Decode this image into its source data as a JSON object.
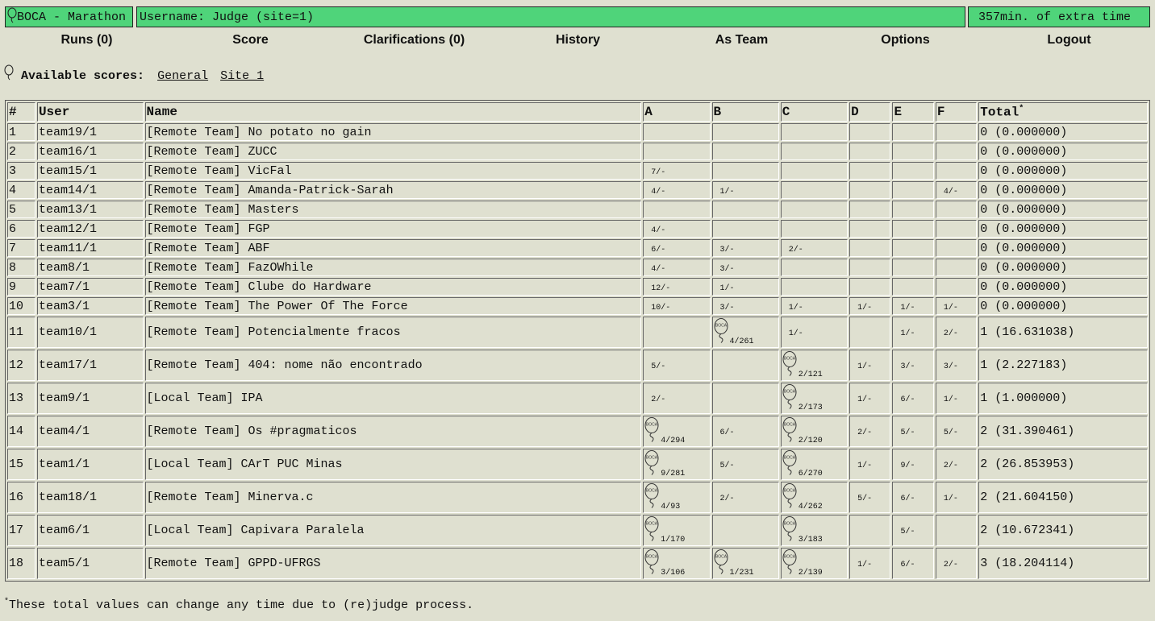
{
  "topbar": {
    "logo_text": "BOCA - Marathon",
    "user_text": "Username: Judge (site=1)",
    "time_text": "357min. of extra time",
    "bar_color": "#4fd47a"
  },
  "menu": [
    "Runs (0)",
    "Score",
    "Clarifications (0)",
    "History",
    "As Team",
    "Options",
    "Logout"
  ],
  "available": {
    "label": "Available scores:",
    "links": [
      "General",
      "Site_1"
    ]
  },
  "table": {
    "headers": [
      "#",
      "User",
      "Name",
      "A",
      "B",
      "C",
      "D",
      "E",
      "F",
      "Total"
    ],
    "total_mark": "*",
    "balloon_text": "BOCA",
    "rows": [
      {
        "pos": "1",
        "user": "team19/1",
        "name": "[Remote Team] No potato no gain",
        "cells": [
          "",
          "",
          "",
          "",
          "",
          ""
        ],
        "total": "0 (0.000000)"
      },
      {
        "pos": "2",
        "user": "team16/1",
        "name": "[Remote Team] ZUCC",
        "cells": [
          "",
          "",
          "",
          "",
          "",
          ""
        ],
        "total": "0 (0.000000)"
      },
      {
        "pos": "3",
        "user": "team15/1",
        "name": "[Remote Team] VicFal",
        "cells": [
          "7/-",
          "",
          "",
          "",
          "",
          ""
        ],
        "total": "0 (0.000000)"
      },
      {
        "pos": "4",
        "user": "team14/1",
        "name": "[Remote Team] Amanda-Patrick-Sarah",
        "cells": [
          "4/-",
          "1/-",
          "",
          "",
          "",
          "4/-"
        ],
        "total": "0 (0.000000)"
      },
      {
        "pos": "5",
        "user": "team13/1",
        "name": "[Remote Team] Masters",
        "cells": [
          "",
          "",
          "",
          "",
          "",
          ""
        ],
        "total": "0 (0.000000)"
      },
      {
        "pos": "6",
        "user": "team12/1",
        "name": "[Remote Team] FGP",
        "cells": [
          "4/-",
          "",
          "",
          "",
          "",
          ""
        ],
        "total": "0 (0.000000)"
      },
      {
        "pos": "7",
        "user": "team11/1",
        "name": "[Remote Team] ABF",
        "cells": [
          "6/-",
          "3/-",
          "2/-",
          "",
          "",
          ""
        ],
        "total": "0 (0.000000)"
      },
      {
        "pos": "8",
        "user": "team8/1",
        "name": "[Remote Team] FazOWhile",
        "cells": [
          "4/-",
          "3/-",
          "",
          "",
          "",
          ""
        ],
        "total": "0 (0.000000)"
      },
      {
        "pos": "9",
        "user": "team7/1",
        "name": "[Remote Team] Clube do Hardware",
        "cells": [
          "12/-",
          "1/-",
          "",
          "",
          "",
          ""
        ],
        "total": "0 (0.000000)"
      },
      {
        "pos": "10",
        "user": "team3/1",
        "name": "[Remote Team] The Power Of The Force",
        "cells": [
          "10/-",
          "3/-",
          "1/-",
          "1/-",
          "1/-",
          "1/-"
        ],
        "total": "0 (0.000000)"
      },
      {
        "pos": "11",
        "user": "team10/1",
        "name": "[Remote Team] Potencialmente fracos",
        "cells": [
          "",
          "*4/261",
          "1/-",
          "",
          "1/-",
          "2/-"
        ],
        "total": "1 (16.631038)"
      },
      {
        "pos": "12",
        "user": "team17/1",
        "name": "[Remote Team] 404: nome não encontrado",
        "cells": [
          "5/-",
          "",
          "*2/121",
          "1/-",
          "3/-",
          "3/-"
        ],
        "total": "1 (2.227183)"
      },
      {
        "pos": "13",
        "user": "team9/1",
        "name": "[Local Team] IPA",
        "cells": [
          "2/-",
          "",
          "*2/173",
          "1/-",
          "6/-",
          "1/-"
        ],
        "total": "1 (1.000000)"
      },
      {
        "pos": "14",
        "user": "team4/1",
        "name": "[Remote Team] Os #pragmaticos",
        "cells": [
          "*4/294",
          "6/-",
          "*2/120",
          "2/-",
          "5/-",
          "5/-"
        ],
        "total": "2 (31.390461)"
      },
      {
        "pos": "15",
        "user": "team1/1",
        "name": "[Local Team] CArT PUC Minas",
        "cells": [
          "*9/281",
          "5/-",
          "*6/270",
          "1/-",
          "9/-",
          "2/-"
        ],
        "total": "2 (26.853953)"
      },
      {
        "pos": "16",
        "user": "team18/1",
        "name": "[Remote Team] Minerva.c",
        "cells": [
          "*4/93",
          "2/-",
          "*4/262",
          "5/-",
          "6/-",
          "1/-"
        ],
        "total": "2 (21.604150)"
      },
      {
        "pos": "17",
        "user": "team6/1",
        "name": "[Local Team] Capivara Paralela",
        "cells": [
          "*1/170",
          "",
          "*3/183",
          "",
          "5/-",
          ""
        ],
        "total": "2 (10.672341)"
      },
      {
        "pos": "18",
        "user": "team5/1",
        "name": "[Remote Team] GPPD-UFRGS",
        "cells": [
          "*3/106",
          "*1/231",
          "*2/139",
          "1/-",
          "6/-",
          "2/-"
        ],
        "total": "3 (18.204114)"
      }
    ]
  },
  "footer": {
    "mark": "*",
    "text": "These total values can change any time due to (re)judge process."
  }
}
